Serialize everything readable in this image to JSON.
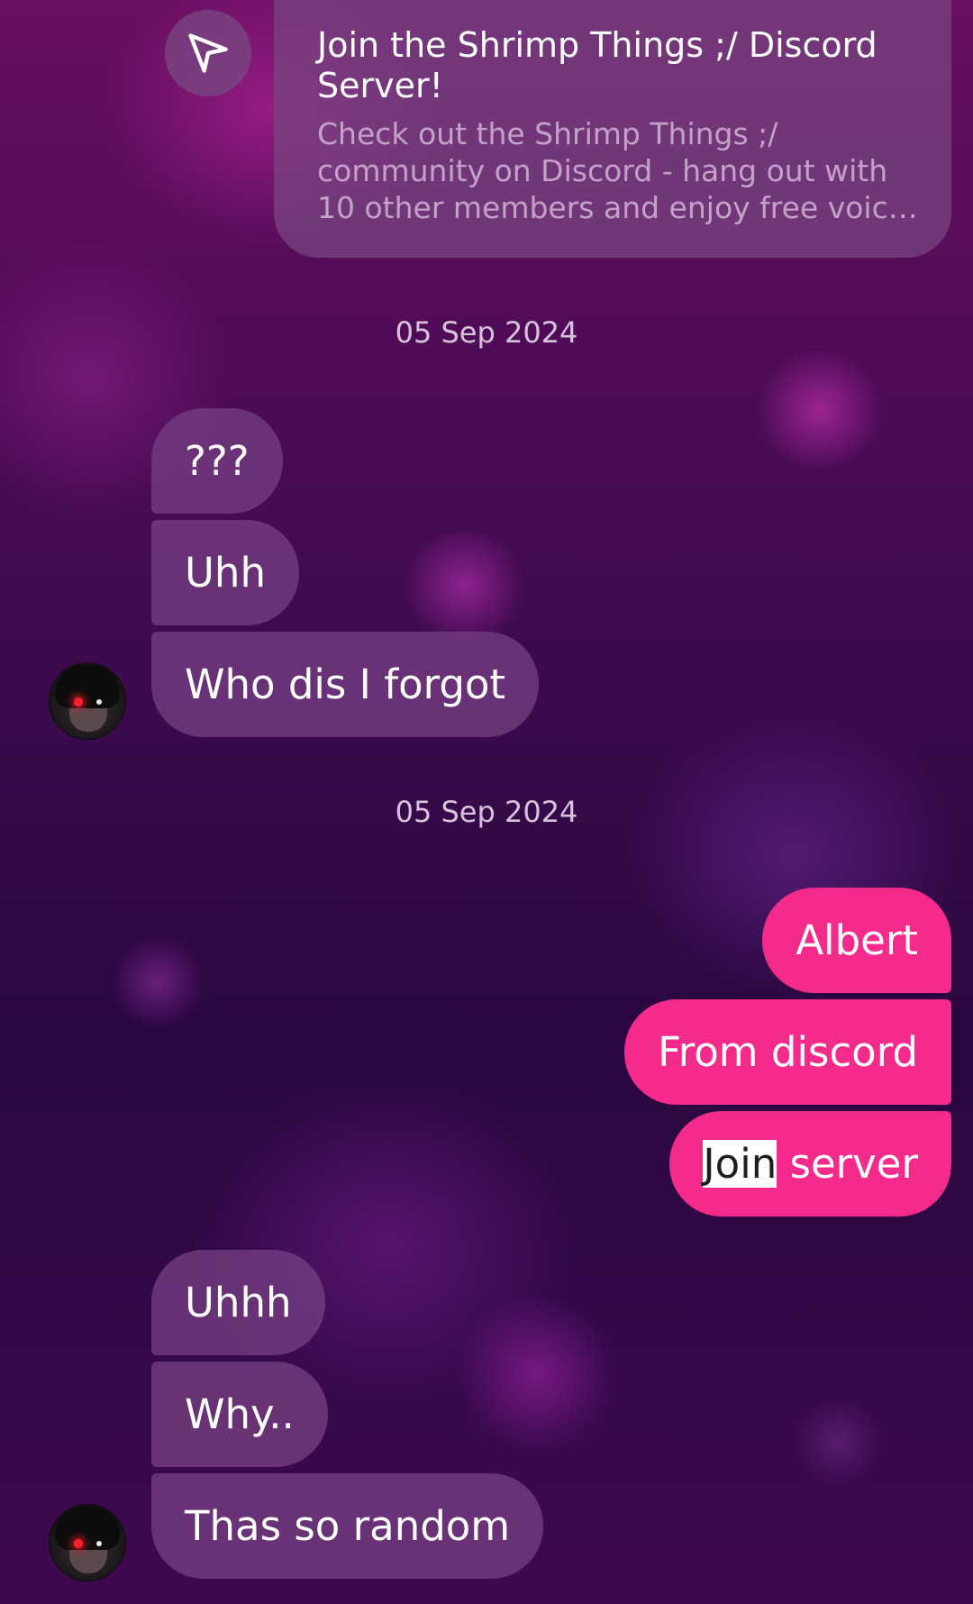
{
  "link_card": {
    "icon": "send-icon",
    "title": "Join the Shrimp Things ;/ Discord Server!",
    "description": "Check out the Shrimp Things ;/ community on Discord - hang out with 10 other members and enjoy free voic…"
  },
  "sections": [
    {
      "date": "05 Sep 2024",
      "incoming": [
        "???",
        "Uhh",
        "Who dis I forgot"
      ]
    },
    {
      "date": "05 Sep 2024",
      "outgoing": [
        "Albert",
        "From discord"
      ],
      "outgoing_last": {
        "highlighted": "Join",
        "rest": " server"
      },
      "incoming": [
        "Uhhh",
        "Why..",
        "Thas so random"
      ]
    }
  ],
  "colors": {
    "outgoing_bubble": "#f42b8a",
    "incoming_bubble": "#763e82",
    "selection_highlight": "#ffffff"
  }
}
